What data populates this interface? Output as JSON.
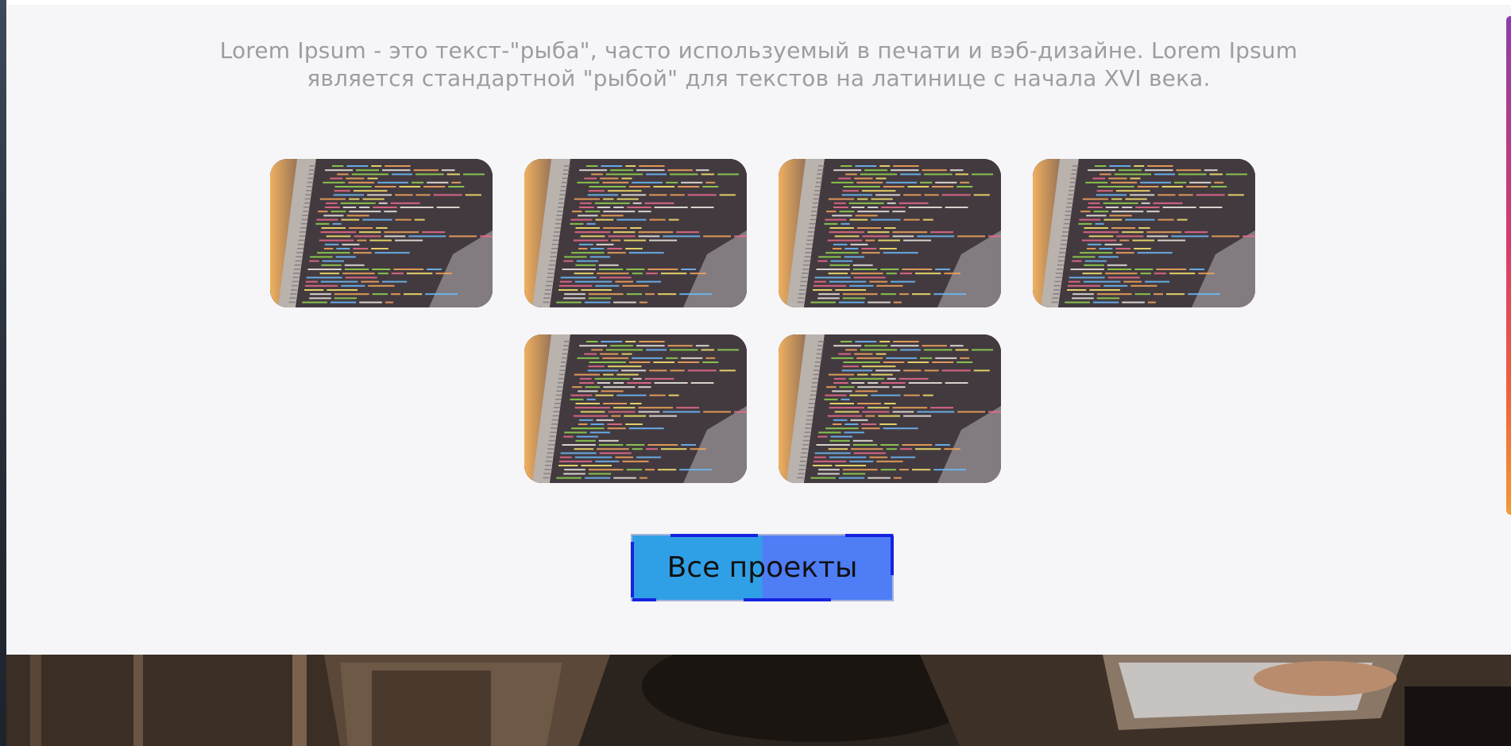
{
  "intro": {
    "line1": "Lorem Ipsum - это текст-\"рыба\", часто используемый в печати и вэб-дизайне. Lorem Ipsum",
    "line2": "является стандартной \"рыбой\" для текстов на латинице с начала XVI века."
  },
  "projects": [
    {
      "image": "code-laptop-photo"
    },
    {
      "image": "code-laptop-photo"
    },
    {
      "image": "code-laptop-photo"
    },
    {
      "image": "code-laptop-photo"
    },
    {
      "image": "code-laptop-photo"
    },
    {
      "image": "code-laptop-photo"
    }
  ],
  "all_projects_button": {
    "label": "Все проекты"
  },
  "colors": {
    "section_bg": "#f6f6f8",
    "intro_text": "#9c9ca3",
    "button_left": "#30a0e6",
    "button_right": "#4f7df6",
    "button_edge": "#1523e0"
  }
}
